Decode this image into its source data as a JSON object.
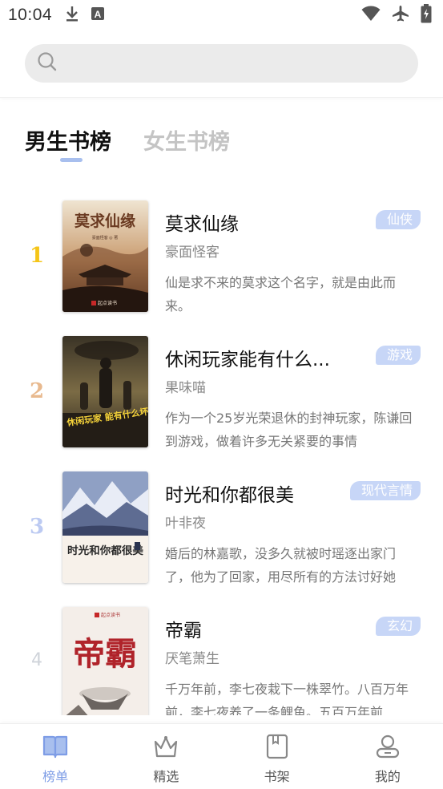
{
  "status_bar": {
    "time": "10:04",
    "icons": [
      "download-icon",
      "a-notification-icon",
      "wifi-icon",
      "airplane-mode-icon",
      "battery-charging-icon"
    ]
  },
  "search": {
    "placeholder": "",
    "icon": "search-icon"
  },
  "tabs": [
    {
      "label": "男生书榜",
      "active": true
    },
    {
      "label": "女生书榜",
      "active": false
    }
  ],
  "books": [
    {
      "rank": "1",
      "rank_color": "#f5c518",
      "title": "莫求仙缘",
      "author": "豪面怪客",
      "genre": "仙侠",
      "description": "仙是求不来的莫求这个名字，就是由此而来。",
      "cover": {
        "title_text": "莫求仙缘",
        "author_text": "豪面怪客 ◎ 著",
        "publisher_text": "起点读书",
        "palette": [
          "#e9dcc7",
          "#8f5a3d",
          "#2b1d17"
        ]
      }
    },
    {
      "rank": "2",
      "rank_color": "#e8b98e",
      "title": "休闲玩家能有什么...",
      "author": "果味喵",
      "genre": "游戏",
      "description": "作为一个25岁光荣退休的封神玩家，陈谦回到游戏，做着许多无关紧要的事情",
      "cover": {
        "title_text": "休闲玩家 能有什么坏心眼",
        "palette": [
          "#6b5a3a",
          "#2f2a22",
          "#f2d13b"
        ]
      }
    },
    {
      "rank": "3",
      "rank_color": "#bccaf2",
      "title": "时光和你都很美",
      "author": "叶非夜",
      "genre": "现代言情",
      "description": "婚后的林嘉歌，没多久就被时瑶逐出家门了，他为了回家，用尽所有的方法讨好她",
      "cover": {
        "title_text": "时光和你都很美",
        "palette": [
          "#8fa0c4",
          "#f5efe8",
          "#c84a3b"
        ]
      }
    },
    {
      "rank": "4",
      "rank_color": "#cfd3da",
      "title": "帝霸",
      "author": "厌笔萧生",
      "genre": "玄幻",
      "description": "千万年前，李七夜栽下一株翠竹。八百万年前，李七夜养了一条鲤鱼。五百万年前",
      "cover": {
        "title_text": "帝霸",
        "publisher_text": "起点读书",
        "palette": [
          "#f3ece6",
          "#b0232a",
          "#444"
        ]
      }
    }
  ],
  "bottom_nav": [
    {
      "label": "榜单",
      "icon": "book-open-icon",
      "active": true
    },
    {
      "label": "精选",
      "icon": "crown-icon",
      "active": false
    },
    {
      "label": "书架",
      "icon": "bookshelf-icon",
      "active": false
    },
    {
      "label": "我的",
      "icon": "profile-icon",
      "active": false
    }
  ],
  "colors": {
    "accent": "#7e9de6",
    "tag_bg": "#c7d6f7",
    "search_bg": "#ebebeb"
  }
}
